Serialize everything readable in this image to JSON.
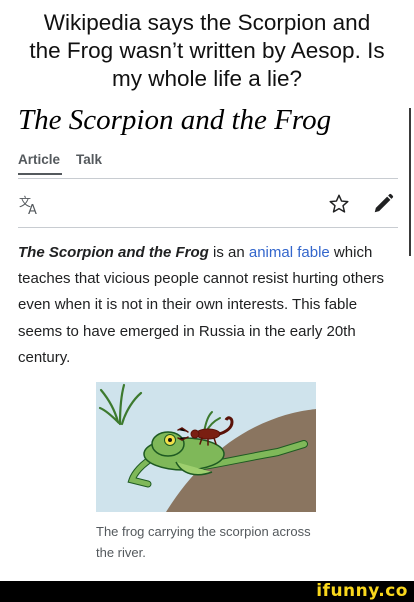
{
  "meme": {
    "caption_line1": "Wikipedia says the Scorpion and",
    "caption_line2": "the Frog wasn’t written by Aesop. Is",
    "caption_line3": "my whole life a lie?"
  },
  "article": {
    "title": "The Scorpion and the Frog",
    "tabs": [
      {
        "label": "Article",
        "active": true
      },
      {
        "label": "Talk",
        "active": false
      }
    ],
    "icons": {
      "language": "translate-icon",
      "watch": "star-icon",
      "edit": "pencil-icon"
    },
    "lead_bold": "The Scorpion and the Frog",
    "text_is_an": " is an ",
    "link_text": "animal fable",
    "text_rest": " which teaches that vicious people cannot resist hurting others even when it is not in their own interests. This fable seems to have emerged in Russia in the early 20th century.",
    "figure_caption": "The frog carrying the scorpion across the river.",
    "colors": {
      "link": "#3366cc",
      "text": "#202122",
      "muted": "#54595d"
    }
  },
  "watermark": {
    "text": "ifunny.co",
    "color": "#f9d71c"
  }
}
